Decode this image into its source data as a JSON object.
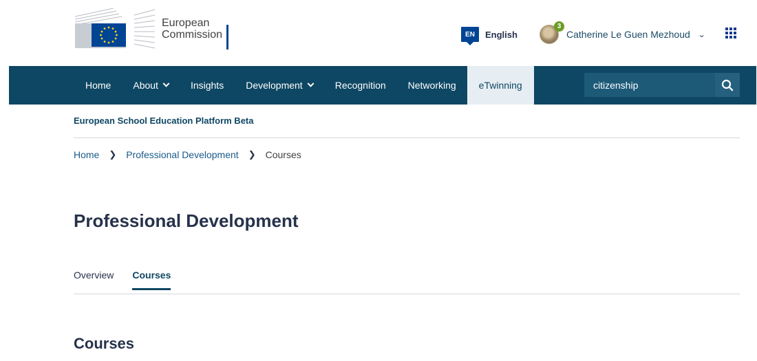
{
  "header": {
    "logo_text_line1": "European",
    "logo_text_line2": "Commission",
    "language": {
      "code": "EN",
      "label": "English"
    },
    "user": {
      "name": "Catherine Le Guen Mezhoud",
      "notification_count": "3"
    },
    "colors": {
      "eu_blue": "#004494",
      "eu_yellow": "#ffd617"
    }
  },
  "nav": {
    "items": [
      {
        "label": "Home",
        "has_dropdown": false
      },
      {
        "label": "About",
        "has_dropdown": true
      },
      {
        "label": "Insights",
        "has_dropdown": false
      },
      {
        "label": "Development",
        "has_dropdown": true
      },
      {
        "label": "Recognition",
        "has_dropdown": false
      },
      {
        "label": "Networking",
        "has_dropdown": false
      },
      {
        "label": "eTwinning",
        "has_dropdown": false,
        "active": true
      }
    ],
    "search_value": "citizenship",
    "colors": {
      "bar": "#0e4763",
      "active_bg": "#e6eef3"
    }
  },
  "site_name": "European School Education Platform Beta",
  "breadcrumb": {
    "items": [
      "Home",
      "Professional Development",
      "Courses"
    ]
  },
  "page_title": "Professional Development",
  "tabs": [
    {
      "label": "Overview",
      "active": false
    },
    {
      "label": "Courses",
      "active": true
    }
  ],
  "section_title": "Courses"
}
